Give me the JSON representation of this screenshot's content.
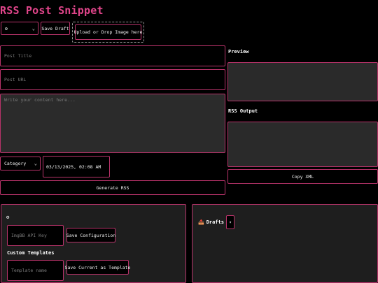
{
  "header": {
    "title": "RSS Post Snippet"
  },
  "toolbar": {
    "selector_value": "⚙",
    "save_draft_label": "Save Draft",
    "upload_label": "Upload or Drop Image here"
  },
  "form": {
    "title_placeholder": "Post Title",
    "url_placeholder": "Post URL",
    "content_placeholder": "Write your content here...",
    "category_value": "Category",
    "datetime_value": "03/13/2025, 02:08 AM",
    "generate_label": "Generate RSS"
  },
  "right": {
    "preview_label": "Preview",
    "rss_output_label": "RSS Output",
    "copy_xml_label": "Copy XML"
  },
  "config_panel": {
    "gear_glyph": "⚙",
    "api_key_placeholder": "ImgBB API Key",
    "save_config_label": "Save Configuration",
    "custom_templates_label": "Custom Templates",
    "template_name_placeholder": "Template name",
    "save_template_label": "Save Current as Template"
  },
  "drafts_panel": {
    "drafts_icon": "📤",
    "drafts_label": "Drafts",
    "toggle_glyph": "▾"
  },
  "colors": {
    "accent": "#e0458a",
    "border": "#b8336a",
    "panel_bg": "#1e1e1e",
    "field_bg": "#2a2a2a"
  }
}
